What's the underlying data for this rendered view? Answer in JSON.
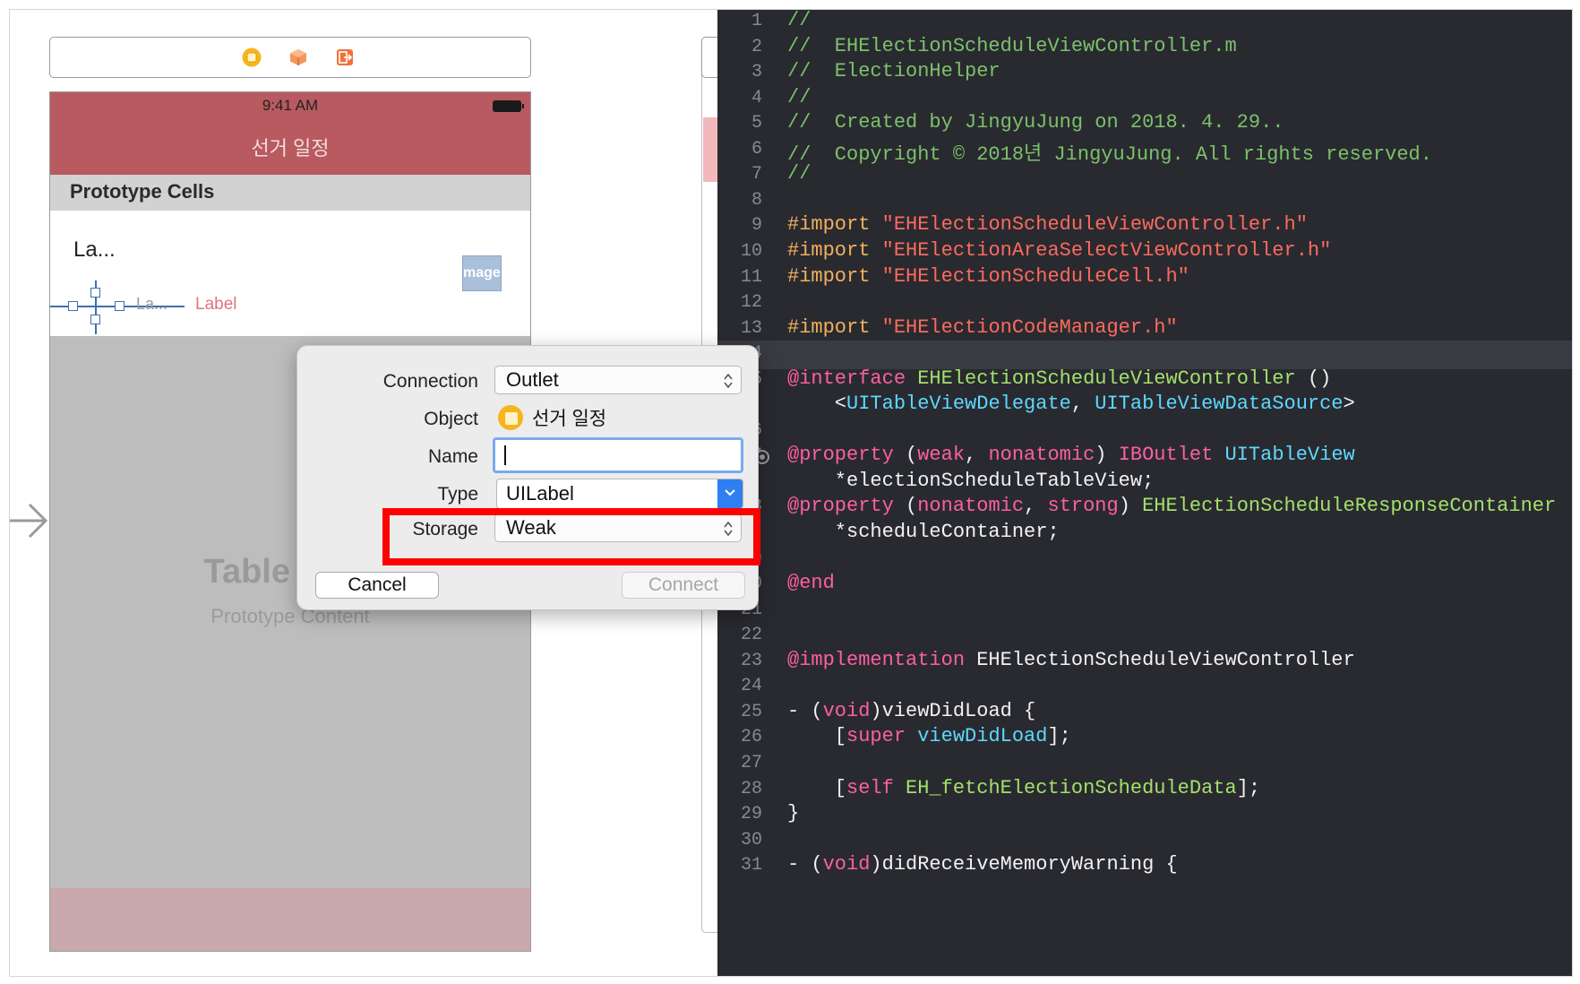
{
  "canvas": {
    "status_time": "9:41 AM",
    "nav_title": "선거 일정",
    "prototype_header": "Prototype Cells",
    "cell_title": "La...",
    "cell_image_text": "mageV",
    "cell_subtitle": "La...",
    "cell_label": "Label",
    "table_view_title": "Table View",
    "table_view_subtitle": "Prototype Content"
  },
  "popover": {
    "connection_label": "Connection",
    "connection_value": "Outlet",
    "object_label": "Object",
    "object_value": "선거 일정",
    "name_label": "Name",
    "name_value": "",
    "type_label": "Type",
    "type_value": "UILabel",
    "storage_label": "Storage",
    "storage_value": "Weak",
    "cancel_label": "Cancel",
    "connect_label": "Connect"
  },
  "code_lines": [
    {
      "n": "1",
      "t": [
        [
          "c-comment",
          "//"
        ]
      ]
    },
    {
      "n": "2",
      "t": [
        [
          "c-comment",
          "//  EHElectionScheduleViewController.m"
        ]
      ]
    },
    {
      "n": "3",
      "t": [
        [
          "c-comment",
          "//  ElectionHelper"
        ]
      ]
    },
    {
      "n": "4",
      "t": [
        [
          "c-comment",
          "//"
        ]
      ]
    },
    {
      "n": "5",
      "t": [
        [
          "c-comment",
          "//  Created by JingyuJung on 2018. 4. 29.."
        ]
      ]
    },
    {
      "n": "6",
      "t": [
        [
          "c-comment",
          "//  Copyright © 2018년 JingyuJung. All rights reserved."
        ]
      ]
    },
    {
      "n": "7",
      "t": [
        [
          "c-comment",
          "//"
        ]
      ]
    },
    {
      "n": "8",
      "t": []
    },
    {
      "n": "9",
      "t": [
        [
          "c-pre",
          "#import "
        ],
        [
          "c-str",
          "\"EHElectionScheduleViewController.h\""
        ]
      ]
    },
    {
      "n": "10",
      "t": [
        [
          "c-pre",
          "#import "
        ],
        [
          "c-str",
          "\"EHElectionAreaSelectViewController.h\""
        ]
      ]
    },
    {
      "n": "11",
      "t": [
        [
          "c-pre",
          "#import "
        ],
        [
          "c-str",
          "\"EHElectionScheduleCell.h\""
        ]
      ]
    },
    {
      "n": "12",
      "t": []
    },
    {
      "n": "13",
      "t": [
        [
          "c-pre",
          "#import "
        ],
        [
          "c-str",
          "\"EHElectionCodeManager.h\""
        ]
      ]
    },
    {
      "n": "14",
      "t": [],
      "current": true
    },
    {
      "n": "15",
      "t": [
        [
          "c-kw",
          "@interface "
        ],
        [
          "c-cls",
          "EHElectionScheduleViewController "
        ],
        [
          "c-plain",
          "()"
        ]
      ]
    },
    {
      "n": "",
      "t": [
        [
          "c-plain",
          "    <"
        ],
        [
          "c-type",
          "UITableViewDelegate"
        ],
        [
          "c-plain",
          ", "
        ],
        [
          "c-type",
          "UITableViewDataSource"
        ],
        [
          "c-plain",
          ">"
        ]
      ]
    },
    {
      "n": "16",
      "t": []
    },
    {
      "n": "17",
      "t": [
        [
          "c-kw",
          "@property "
        ],
        [
          "c-plain",
          "("
        ],
        [
          "c-kw",
          "weak"
        ],
        [
          "c-plain",
          ", "
        ],
        [
          "c-kw",
          "nonatomic"
        ],
        [
          "c-plain",
          ") "
        ],
        [
          "c-kw",
          "IBOutlet "
        ],
        [
          "c-type",
          "UITableView"
        ]
      ],
      "bp": true
    },
    {
      "n": "",
      "t": [
        [
          "c-plain",
          "    *electionScheduleTableView;"
        ]
      ]
    },
    {
      "n": "18",
      "t": [
        [
          "c-kw",
          "@property "
        ],
        [
          "c-plain",
          "("
        ],
        [
          "c-kw",
          "nonatomic"
        ],
        [
          "c-plain",
          ", "
        ],
        [
          "c-kw",
          "strong"
        ],
        [
          "c-plain",
          ") "
        ],
        [
          "c-cls",
          "EHElectionScheduleResponseContainer"
        ]
      ]
    },
    {
      "n": "",
      "t": [
        [
          "c-plain",
          "    *scheduleContainer;"
        ]
      ]
    },
    {
      "n": "19",
      "t": []
    },
    {
      "n": "20",
      "t": [
        [
          "c-kw",
          "@end"
        ]
      ]
    },
    {
      "n": "21",
      "t": []
    },
    {
      "n": "22",
      "t": []
    },
    {
      "n": "23",
      "t": [
        [
          "c-kw",
          "@implementation "
        ],
        [
          "c-plain",
          "EHElectionScheduleViewController"
        ]
      ]
    },
    {
      "n": "24",
      "t": []
    },
    {
      "n": "25",
      "t": [
        [
          "c-plain",
          "- ("
        ],
        [
          "c-kw",
          "void"
        ],
        [
          "c-plain",
          ")viewDidLoad {"
        ]
      ]
    },
    {
      "n": "26",
      "t": [
        [
          "c-plain",
          "    ["
        ],
        [
          "c-kw",
          "super "
        ],
        [
          "c-type",
          "viewDidLoad"
        ],
        [
          "c-plain",
          "];"
        ]
      ]
    },
    {
      "n": "27",
      "t": []
    },
    {
      "n": "28",
      "t": [
        [
          "c-plain",
          "    ["
        ],
        [
          "c-kw",
          "self "
        ],
        [
          "c-cls",
          "EH_fetchElectionScheduleData"
        ],
        [
          "c-plain",
          "];"
        ]
      ]
    },
    {
      "n": "29",
      "t": [
        [
          "c-plain",
          "}"
        ]
      ]
    },
    {
      "n": "30",
      "t": []
    },
    {
      "n": "31",
      "t": [
        [
          "c-plain",
          "- ("
        ],
        [
          "c-kw",
          "void"
        ],
        [
          "c-plain",
          ")didReceiveMemoryWarning {"
        ]
      ]
    }
  ]
}
